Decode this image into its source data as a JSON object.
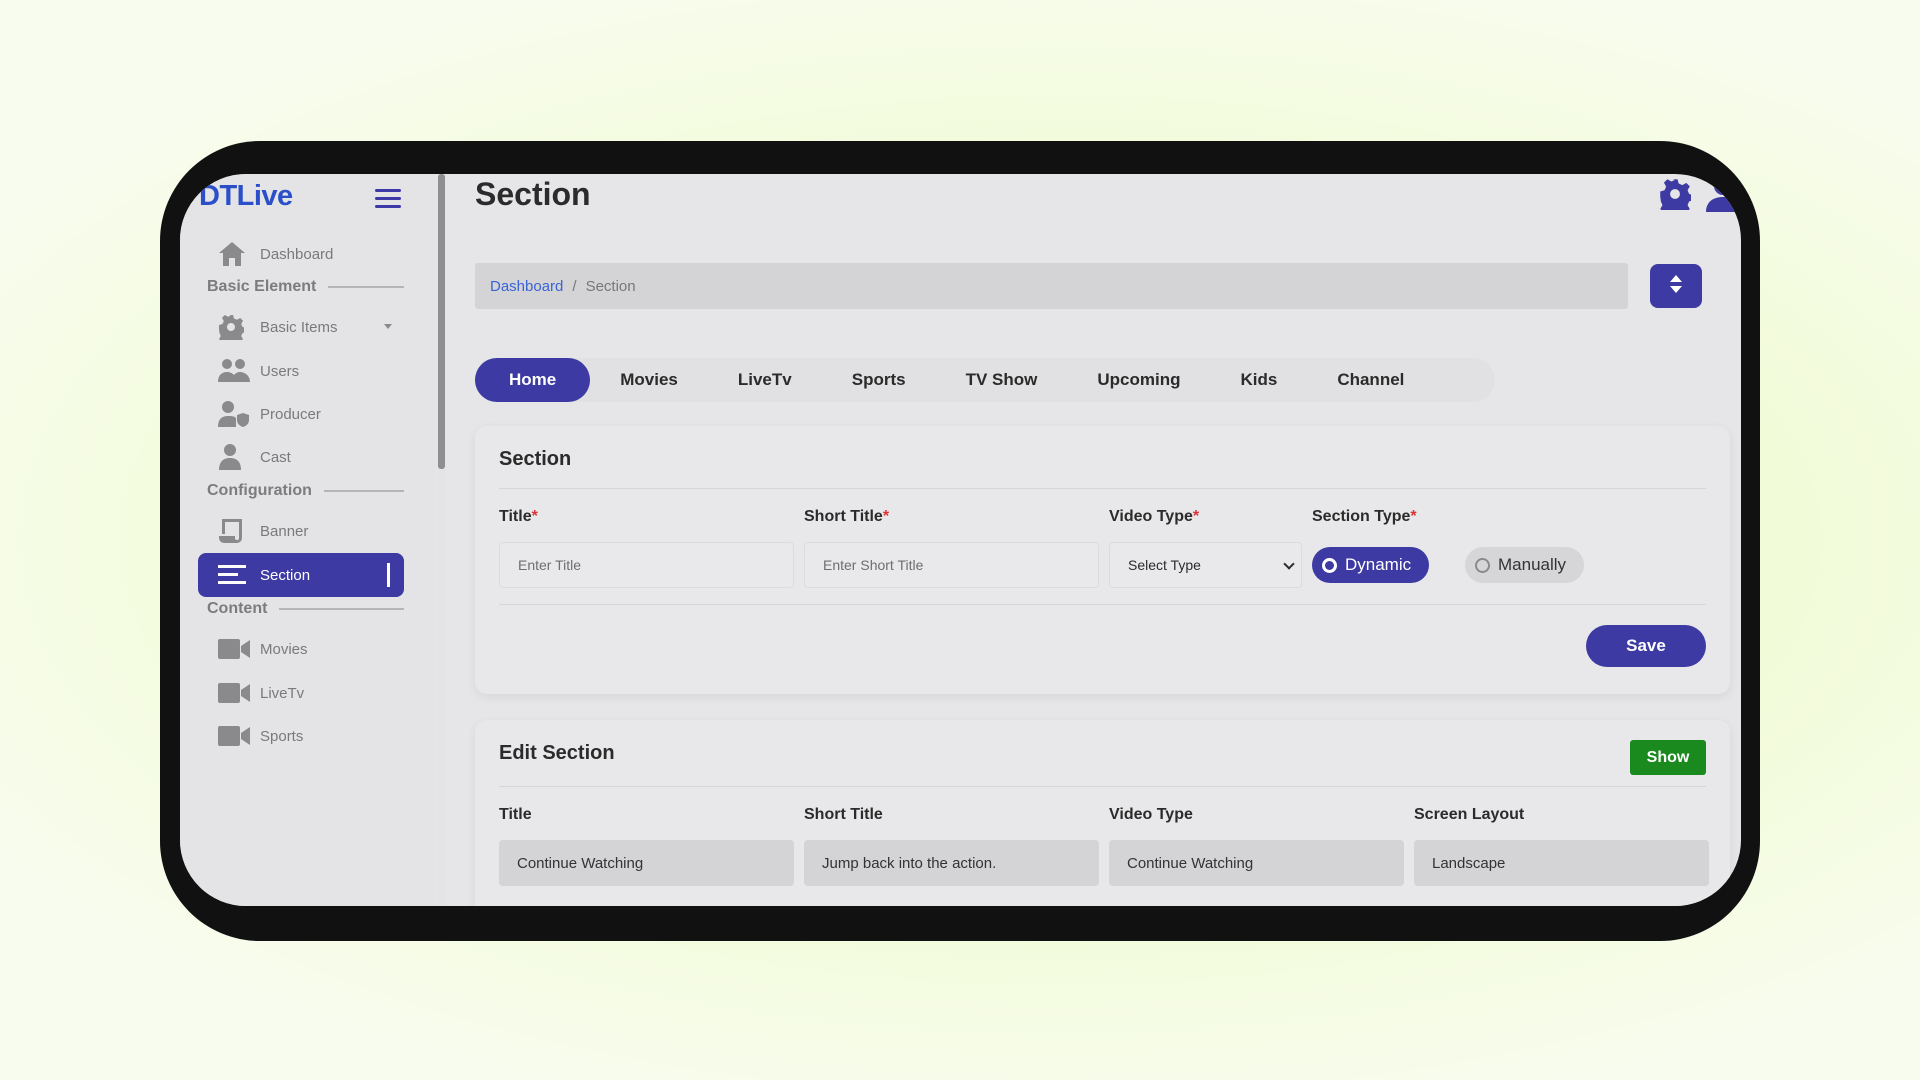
{
  "app": {
    "logo": "DTLive"
  },
  "sidebar": {
    "items": [
      {
        "label": "Dashboard"
      },
      {
        "group": "Basic Element"
      },
      {
        "label": "Basic Items"
      },
      {
        "label": "Users"
      },
      {
        "label": "Producer"
      },
      {
        "label": "Cast"
      },
      {
        "group": "Configuration"
      },
      {
        "label": "Banner"
      },
      {
        "label": "Section"
      },
      {
        "group": "Content"
      },
      {
        "label": "Movies"
      },
      {
        "label": "LiveTv"
      },
      {
        "label": "Sports"
      }
    ]
  },
  "header": {
    "title": "Section"
  },
  "breadcrumb": {
    "home": "Dashboard",
    "separator": "/",
    "current": "Section"
  },
  "tabs": [
    "Home",
    "Movies",
    "LiveTv",
    "Sports",
    "TV Show",
    "Upcoming",
    "Kids",
    "Channel"
  ],
  "form": {
    "title": "Section",
    "title_label": "Title",
    "title_placeholder": "Enter Title",
    "short_title_label": "Short Title",
    "short_title_placeholder": "Enter Short Title",
    "video_type_label": "Video Type",
    "video_type_value": "Select Type",
    "section_type_label": "Section Type",
    "required_mark": "*",
    "option_dynamic": "Dynamic",
    "option_manually": "Manually",
    "save_label": "Save"
  },
  "edit": {
    "title": "Edit Section",
    "show_label": "Show",
    "headers": [
      "Title",
      "Short Title",
      "Video Type",
      "Screen Layout"
    ],
    "row": [
      "Continue Watching",
      "Jump back into the action.",
      "Continue Watching",
      "Landscape"
    ]
  },
  "colors": {
    "primary": "#3d3aa3",
    "logo": "#2a4fc9",
    "show": "#1a8a1f",
    "link": "#3a63d6"
  }
}
